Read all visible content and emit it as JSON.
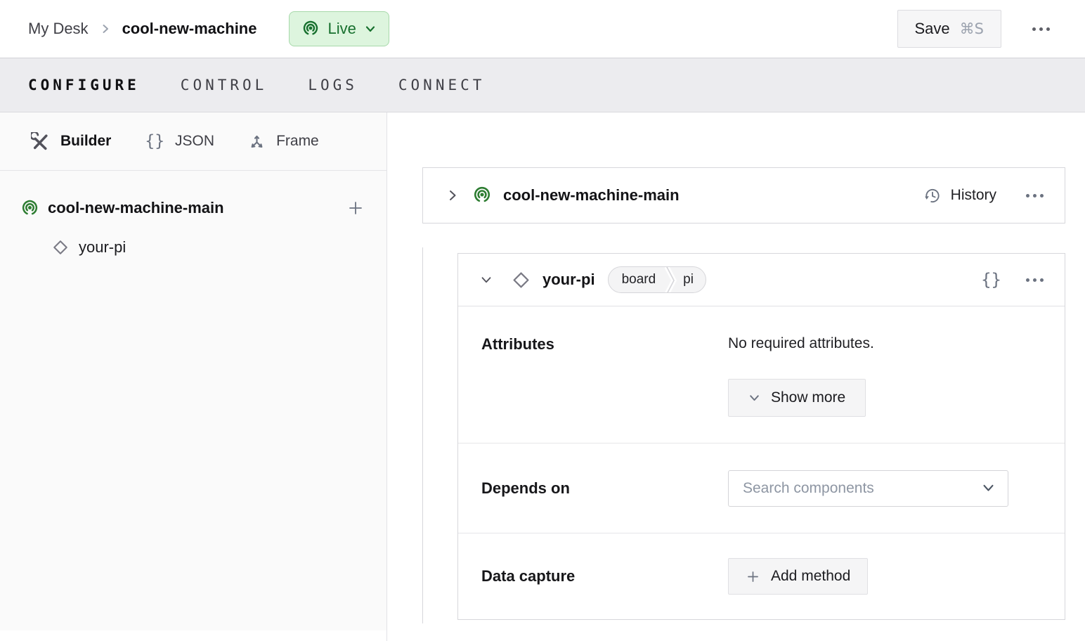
{
  "topbar": {
    "breadcrumb": {
      "parent": "My Desk",
      "current": "cool-new-machine"
    },
    "status": {
      "label": "Live"
    },
    "save": {
      "label": "Save",
      "shortcut": "⌘S"
    }
  },
  "tabs": [
    {
      "label": "CONFIGURE",
      "active": true
    },
    {
      "label": "CONTROL",
      "active": false
    },
    {
      "label": "LOGS",
      "active": false
    },
    {
      "label": "CONNECT",
      "active": false
    }
  ],
  "sidebar": {
    "view_tabs": [
      {
        "label": "Builder",
        "icon": "tools-icon",
        "active": true
      },
      {
        "label": "JSON",
        "icon": "braces-icon",
        "active": false
      },
      {
        "label": "Frame",
        "icon": "axes-icon",
        "active": false
      }
    ],
    "tree": {
      "root": {
        "label": "cool-new-machine-main"
      },
      "children": [
        {
          "label": "your-pi"
        }
      ]
    }
  },
  "main": {
    "machine_card": {
      "title": "cool-new-machine-main",
      "history_label": "History"
    },
    "component_card": {
      "title": "your-pi",
      "type_badge": {
        "type": "board",
        "model": "pi"
      },
      "sections": {
        "attributes": {
          "label": "Attributes",
          "empty_text": "No required attributes.",
          "show_more_label": "Show more"
        },
        "depends_on": {
          "label": "Depends on",
          "placeholder": "Search components"
        },
        "data_capture": {
          "label": "Data capture",
          "add_method_label": "Add method"
        }
      }
    }
  },
  "colors": {
    "accent_green": "#2e7d32",
    "live_bg": "#ddf5de",
    "live_border": "#a7d9aa",
    "live_text": "#17702e",
    "tabbar_bg": "#ececef",
    "card_border": "#d7d7db",
    "button_bg": "#f5f5f6"
  }
}
